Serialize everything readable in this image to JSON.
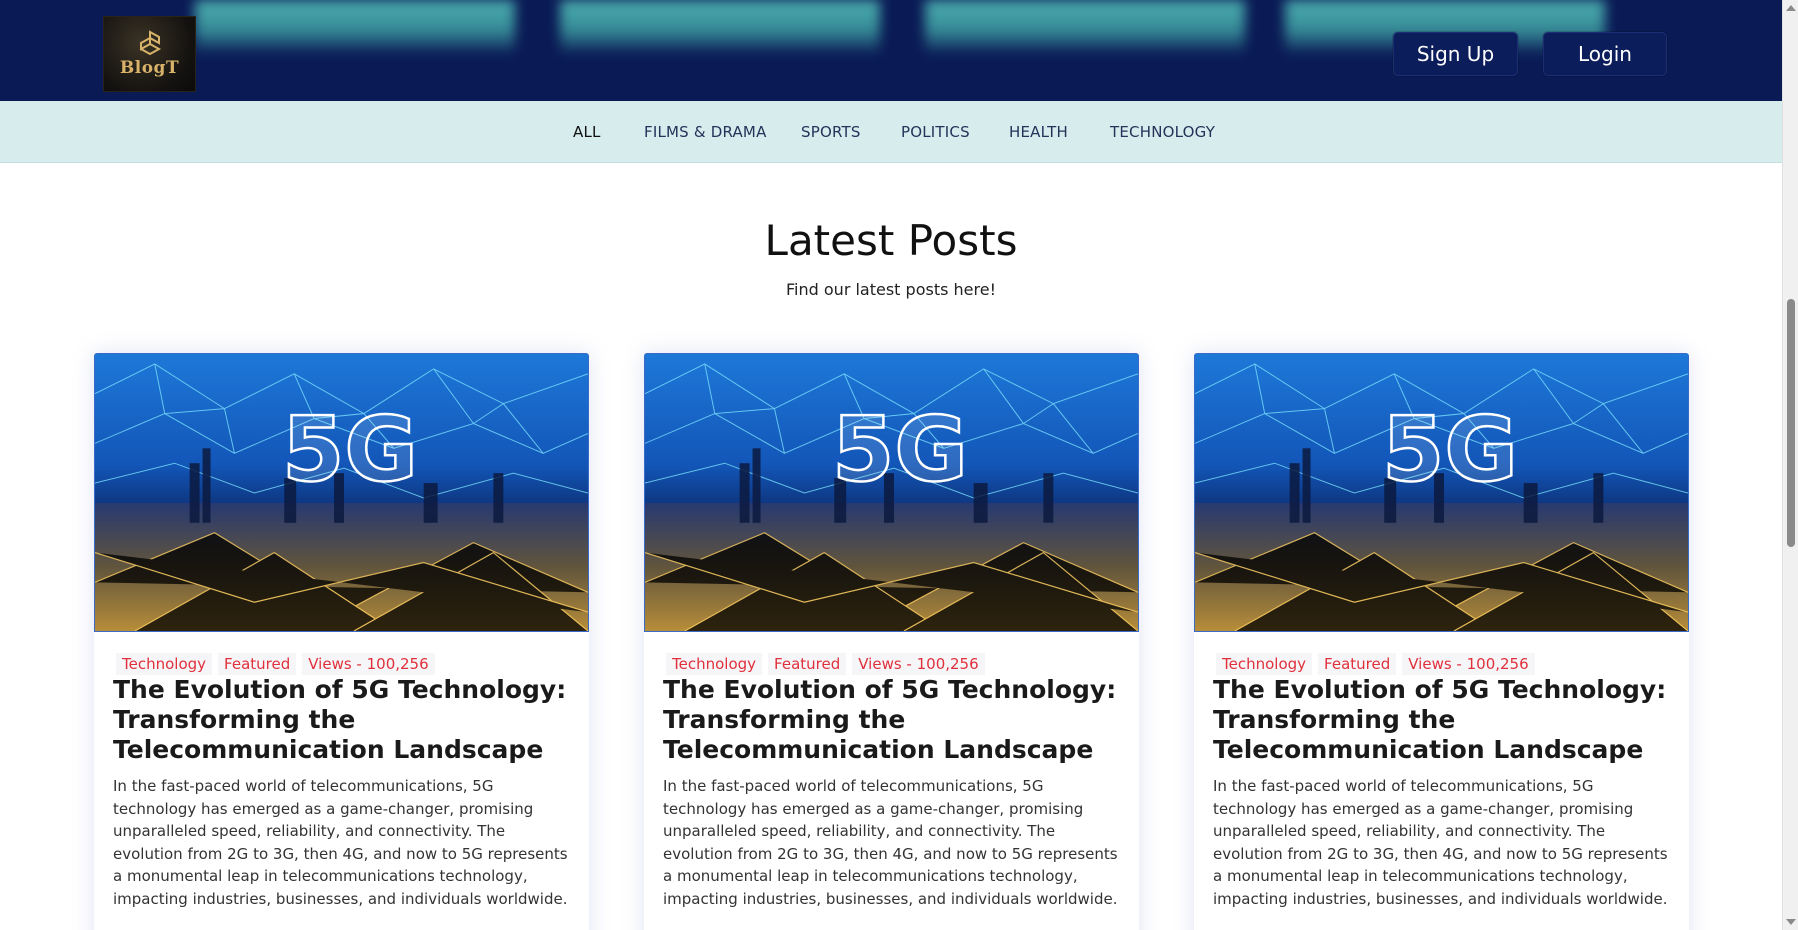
{
  "header": {
    "logo_text": "BlogT",
    "signup_label": "Sign Up",
    "login_label": "Login"
  },
  "nav": {
    "items": [
      {
        "label": "ALL",
        "active": true
      },
      {
        "label": "FILMS & DRAMA",
        "active": false
      },
      {
        "label": "SPORTS",
        "active": false
      },
      {
        "label": "POLITICS",
        "active": false
      },
      {
        "label": "HEALTH",
        "active": false
      },
      {
        "label": "TECHNOLOGY",
        "active": false
      }
    ]
  },
  "section": {
    "title": "Latest Posts",
    "subtitle": "Find our latest posts here!"
  },
  "image_text": "5G",
  "posts": [
    {
      "category": "Technology",
      "badge": "Featured",
      "views": "Views - 100,256",
      "title": "The Evolution of 5G Technology: Transforming the Telecommunication Landscape",
      "excerpt": "In the fast-paced world of telecommunications, 5G technology has emerged as a game-changer, promising unparalleled speed, reliability, and connectivity. The evolution from 2G to 3G, then 4G, and now to 5G represents a monumental leap in telecommunications technology, impacting industries, businesses, and individuals worldwide."
    },
    {
      "category": "Technology",
      "badge": "Featured",
      "views": "Views - 100,256",
      "title": "The Evolution of 5G Technology: Transforming the Telecommunication Landscape",
      "excerpt": "In the fast-paced world of telecommunications, 5G technology has emerged as a game-changer, promising unparalleled speed, reliability, and connectivity. The evolution from 2G to 3G, then 4G, and now to 5G represents a monumental leap in telecommunications technology, impacting industries, businesses, and individuals worldwide."
    },
    {
      "category": "Technology",
      "badge": "Featured",
      "views": "Views - 100,256",
      "title": "The Evolution of 5G Technology: Transforming the Telecommunication Landscape",
      "excerpt": "In the fast-paced world of telecommunications, 5G technology has emerged as a game-changer, promising unparalleled speed, reliability, and connectivity. The evolution from 2G to 3G, then 4G, and now to 5G represents a monumental leap in telecommunications technology, impacting industries, businesses, and individuals worldwide."
    }
  ],
  "colors": {
    "header_bg": "#0a1a55",
    "nav_bg": "#d7ecec",
    "tag_color": "#e0303c",
    "accent_teal": "#58c8c0"
  }
}
